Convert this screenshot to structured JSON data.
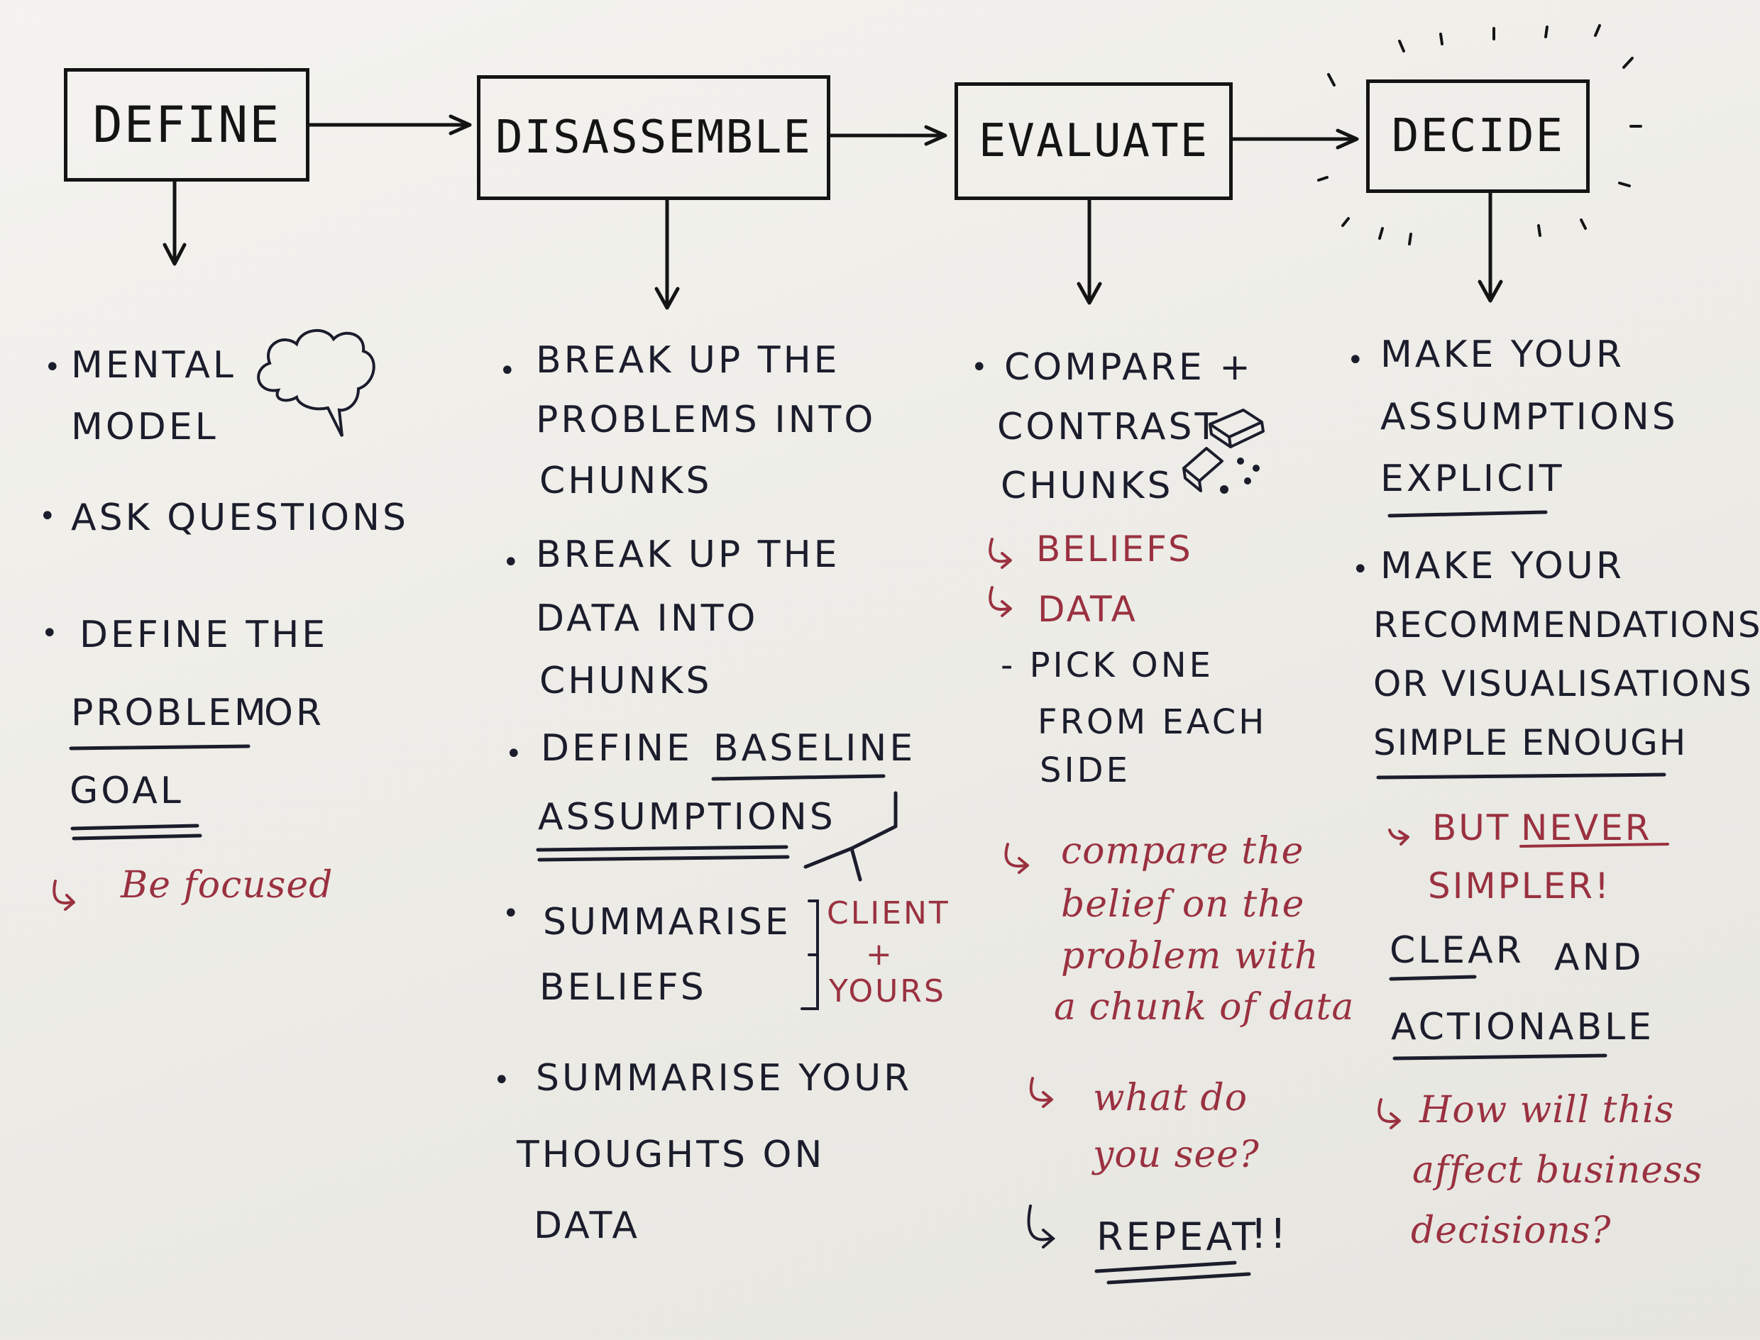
{
  "steps": [
    "DEFINE",
    "DISASSEMBLE",
    "EVALUATE",
    "DECIDE"
  ],
  "define": {
    "mental_model_1": "MENTAL",
    "mental_model_2": "MODEL",
    "ask_questions": "ASK QUESTIONS",
    "define_the": "DEFINE THE",
    "problem": "PROBLEM",
    "or": "OR",
    "goal": "GOAL",
    "be_focused": "Be focused"
  },
  "disassemble": {
    "problems_1": "BREAK UP THE",
    "problems_2": "PROBLEMS INTO",
    "problems_3": "CHUNKS",
    "data_1": "BREAK UP THE",
    "data_2": "DATA INTO",
    "data_3": "CHUNKS",
    "define": "DEFINE",
    "baseline": "BASELINE",
    "assumptions": "ASSUMPTIONS",
    "summarise_beliefs_1": "SUMMARISE",
    "summarise_beliefs_2": "BELIEFS",
    "client": "CLIENT",
    "plus": "+",
    "yours": "YOURS",
    "summarise_thoughts_1": "SUMMARISE YOUR",
    "summarise_thoughts_2": "THOUGHTS ON",
    "summarise_thoughts_3": "DATA"
  },
  "evaluate": {
    "compare_1": "COMPARE +",
    "compare_2": "CONTRAST",
    "compare_3": "CHUNKS",
    "beliefs": "BELIEFS",
    "data": "DATA",
    "pick_1": "- PICK ONE",
    "pick_2": "FROM EACH",
    "pick_3": "SIDE",
    "note_1": "compare the",
    "note_2": "belief on the",
    "note_3": "problem with",
    "note_4": "a chunk of data",
    "see_1": "what do",
    "see_2": "you see?",
    "repeat": "REPEAT",
    "repeat_marks": "!!"
  },
  "decide": {
    "assumptions_1": "MAKE YOUR",
    "assumptions_2": "ASSUMPTIONS",
    "assumptions_3": "EXPLICIT",
    "recs_1": "MAKE YOUR",
    "recs_2": "RECOMMENDATIONS",
    "recs_3": "OR VISUALISATIONS",
    "recs_4": "SIMPLE ENOUGH",
    "but": "BUT",
    "never": "NEVER",
    "simpler": "SIMPLER!",
    "clear": "CLEAR",
    "and": "AND",
    "actionable": "ACTIONABLE",
    "how_1": "How will this",
    "how_2": "affect business",
    "how_3": "decisions?"
  },
  "colors": {
    "ink": "#1b1d2c",
    "red_ink": "#9a3140",
    "paper": "#f2f1ec"
  }
}
